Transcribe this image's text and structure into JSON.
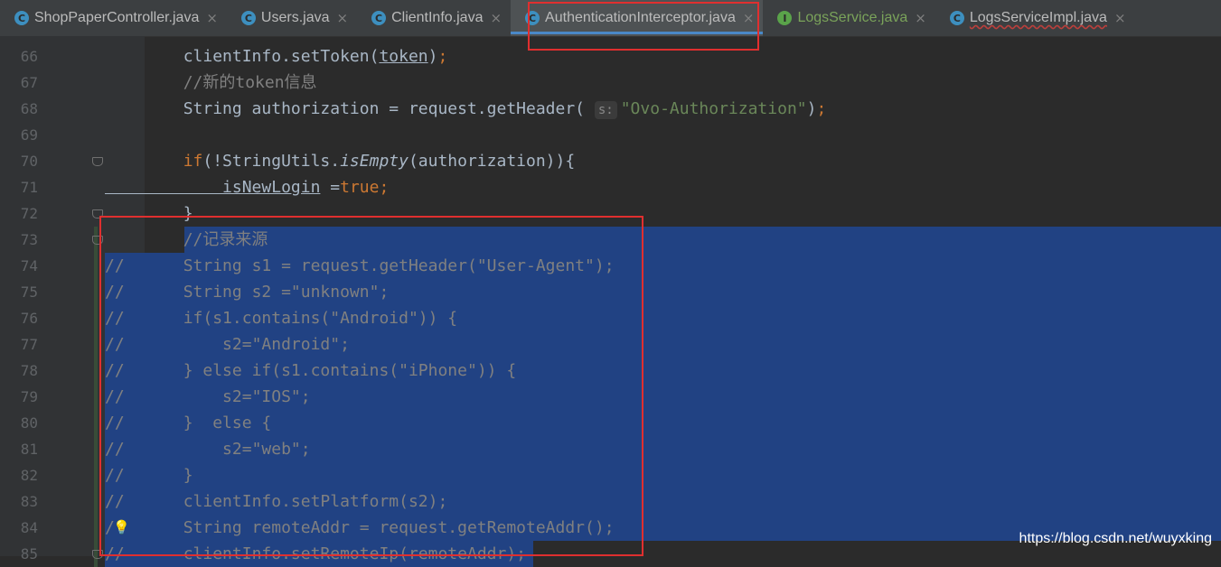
{
  "tabs": [
    {
      "label": "ShopPaperController.java",
      "icon": "class-icon",
      "kind": "cls",
      "active": false,
      "style": ""
    },
    {
      "label": "Users.java",
      "icon": "class-icon",
      "kind": "cls",
      "active": false,
      "style": ""
    },
    {
      "label": "ClientInfo.java",
      "icon": "class-icon",
      "kind": "cls",
      "active": false,
      "style": ""
    },
    {
      "label": "AuthenticationInterceptor.java",
      "icon": "class-icon",
      "kind": "cls",
      "active": true,
      "style": ""
    },
    {
      "label": "LogsService.java",
      "icon": "interface-icon",
      "kind": "itf",
      "active": false,
      "style": "green"
    },
    {
      "label": "LogsServiceImpl.java",
      "icon": "class-icon",
      "kind": "cls",
      "active": false,
      "style": "err"
    }
  ],
  "close_glyph": "×",
  "param_hint": "s:",
  "lines": [
    {
      "n": "66",
      "prefix": "",
      "tokens": [
        [
          "plain",
          "        clientInfo.setToken("
        ],
        [
          "plain ul",
          "token"
        ],
        [
          "plain",
          ")"
        ],
        [
          "kw",
          ";"
        ]
      ]
    },
    {
      "n": "67",
      "prefix": "",
      "tokens": [
        [
          "cmt",
          "        //新的token信息"
        ]
      ]
    },
    {
      "n": "68",
      "prefix": "",
      "tokens": [
        [
          "plain",
          "        String authorization = request.getHeader( "
        ],
        [
          "hint",
          "s:"
        ],
        [
          "str",
          "\"Ovo-Authorization\""
        ],
        [
          "plain",
          ")"
        ],
        [
          "kw",
          ";"
        ]
      ]
    },
    {
      "n": "69",
      "prefix": "",
      "tokens": []
    },
    {
      "n": "70",
      "prefix": "",
      "tokens": [
        [
          "kw",
          "        if"
        ],
        [
          "plain",
          "(!StringUtils."
        ],
        [
          "plain it",
          "isEmpty"
        ],
        [
          "plain",
          "(authorization)){"
        ]
      ]
    },
    {
      "n": "71",
      "prefix": "",
      "tokens": [
        [
          "plain ul",
          "            isNewLogin"
        ],
        [
          "plain",
          " ="
        ],
        [
          "kw",
          "true;"
        ]
      ]
    },
    {
      "n": "72",
      "prefix": "",
      "tokens": [
        [
          "plain",
          "        }"
        ]
      ]
    },
    {
      "n": "73",
      "prefix": "",
      "tokens": [
        [
          "cmt",
          "        //记录来源"
        ]
      ]
    },
    {
      "n": "74",
      "prefix": "//",
      "tokens": [
        [
          "cmt",
          "      String s1 = request.getHeader(\"User-Agent\");"
        ]
      ]
    },
    {
      "n": "75",
      "prefix": "//",
      "tokens": [
        [
          "cmt",
          "      String s2 =\"unknown\";"
        ]
      ]
    },
    {
      "n": "76",
      "prefix": "//",
      "tokens": [
        [
          "cmt",
          "      if(s1.contains(\"Android\")) {"
        ]
      ]
    },
    {
      "n": "77",
      "prefix": "//",
      "tokens": [
        [
          "cmt",
          "          s2=\"Android\";"
        ]
      ]
    },
    {
      "n": "78",
      "prefix": "//",
      "tokens": [
        [
          "cmt",
          "      } else if(s1.contains(\"iPhone\")) {"
        ]
      ]
    },
    {
      "n": "79",
      "prefix": "//",
      "tokens": [
        [
          "cmt",
          "          s2=\"IOS\";"
        ]
      ]
    },
    {
      "n": "80",
      "prefix": "//",
      "tokens": [
        [
          "cmt",
          "      }  else {"
        ]
      ]
    },
    {
      "n": "81",
      "prefix": "//",
      "tokens": [
        [
          "cmt",
          "          s2=\"web\";"
        ]
      ]
    },
    {
      "n": "82",
      "prefix": "//",
      "tokens": [
        [
          "cmt",
          "      }"
        ]
      ]
    },
    {
      "n": "83",
      "prefix": "//",
      "tokens": [
        [
          "cmt",
          "      clientInfo.setPlatform(s2);"
        ]
      ]
    },
    {
      "n": "84",
      "prefix": "/",
      "tokens": [
        [
          "cmt",
          "       String remoteAddr = request.getRemoteAddr();"
        ]
      ]
    },
    {
      "n": "85",
      "prefix": "//",
      "tokens": [
        [
          "cmt",
          "      clientInfo.setRemoteIp(remoteAddr);"
        ]
      ]
    }
  ],
  "watermark": "https://blog.csdn.net/wuyxking",
  "colors": {
    "selection": "#214283",
    "highlight_box": "#e02f2f",
    "active_tab_underline": "#4a88c7"
  }
}
